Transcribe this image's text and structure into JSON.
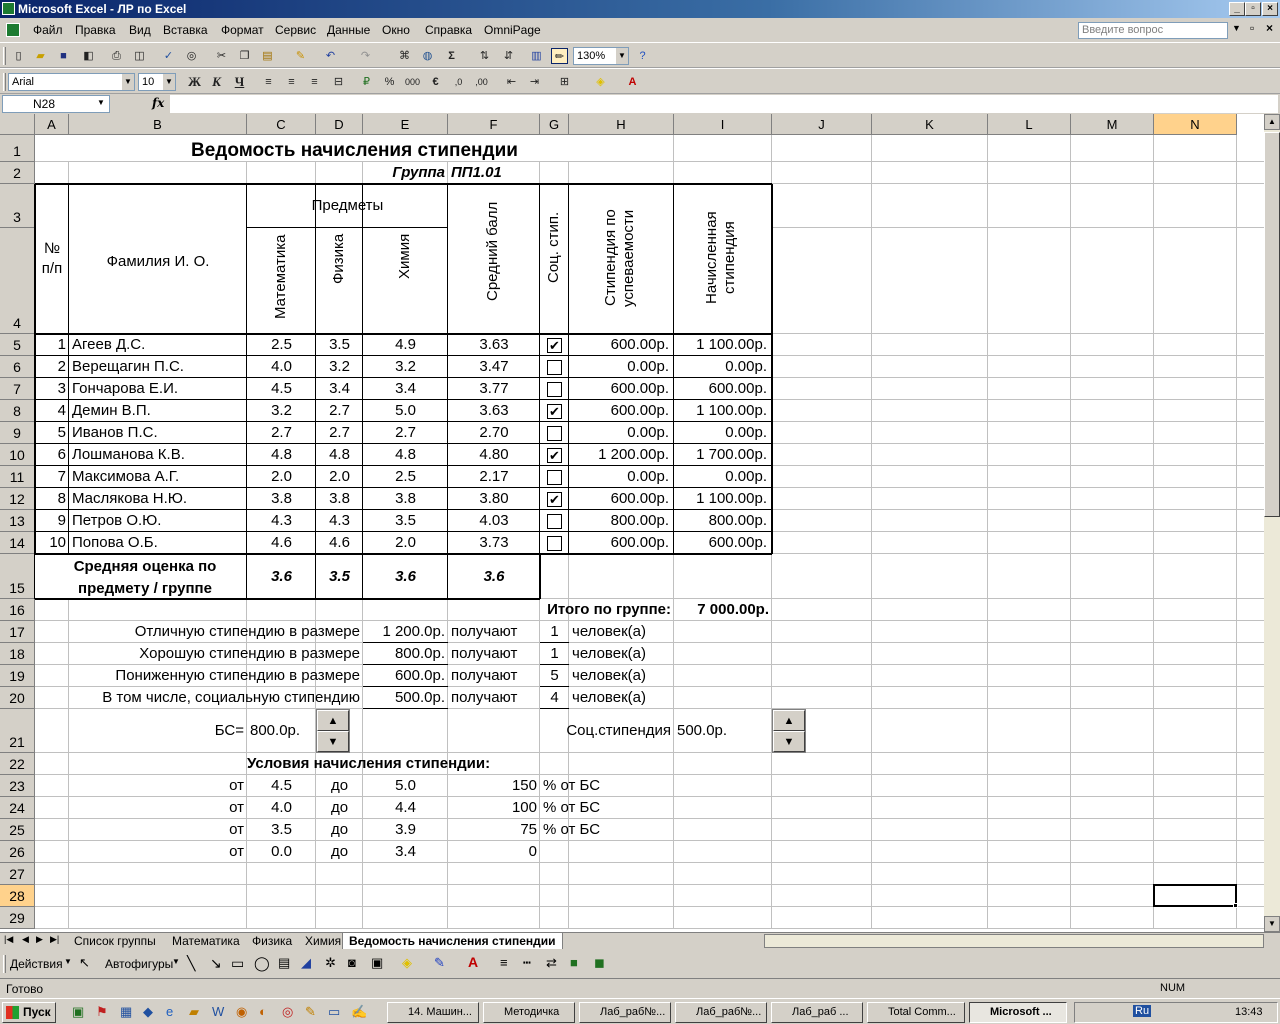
{
  "window": {
    "title": "Microsoft Excel - ЛР по Excel"
  },
  "menu": [
    "Файл",
    "Правка",
    "Вид",
    "Вставка",
    "Формат",
    "Сервис",
    "Данные",
    "Окно",
    "Справка",
    "OmniPage"
  ],
  "ask_placeholder": "Введите вопрос",
  "toolbar": {
    "zoom": "130%",
    "font": "Arial",
    "size": "10"
  },
  "namebox": "N28",
  "columns": [
    "A",
    "B",
    "C",
    "D",
    "E",
    "F",
    "G",
    "H",
    "I",
    "J",
    "K",
    "L",
    "M",
    "N"
  ],
  "rows": [
    "1",
    "2",
    "3",
    "4",
    "5",
    "6",
    "7",
    "8",
    "9",
    "10",
    "11",
    "12",
    "13",
    "14",
    "15",
    "16",
    "17",
    "18",
    "19",
    "20",
    "21",
    "22",
    "23",
    "24",
    "25",
    "26",
    "27",
    "28",
    "29"
  ],
  "sheet": {
    "title": "Ведомость начисления стипендии",
    "group_label": "Группа",
    "group_value": "ПП1.01",
    "hdr_num": "№ п/п",
    "hdr_name": "Фамилия И. О.",
    "hdr_subjects": "Предметы",
    "hdr_math": "Математика",
    "hdr_phys": "Физика",
    "hdr_chem": "Химия",
    "hdr_avg": "Средний балл",
    "hdr_soc": "Соц. стип.",
    "hdr_perf": "Стипендия по успеваемости",
    "hdr_total": "Начисленная стипендия",
    "students": [
      {
        "n": "1",
        "name": "Агеев Д.С.",
        "m": "2.5",
        "p": "3.5",
        "c": "4.9",
        "avg": "3.63",
        "soc": true,
        "perf": "600.00р.",
        "total": "1 100.00р."
      },
      {
        "n": "2",
        "name": "Верещагин П.С.",
        "m": "4.0",
        "p": "3.2",
        "c": "3.2",
        "avg": "3.47",
        "soc": false,
        "perf": "0.00р.",
        "total": "0.00р."
      },
      {
        "n": "3",
        "name": "Гончарова Е.И.",
        "m": "4.5",
        "p": "3.4",
        "c": "3.4",
        "avg": "3.77",
        "soc": false,
        "perf": "600.00р.",
        "total": "600.00р."
      },
      {
        "n": "4",
        "name": "Демин В.П.",
        "m": "3.2",
        "p": "2.7",
        "c": "5.0",
        "avg": "3.63",
        "soc": true,
        "perf": "600.00р.",
        "total": "1 100.00р."
      },
      {
        "n": "5",
        "name": "Иванов П.С.",
        "m": "2.7",
        "p": "2.7",
        "c": "2.7",
        "avg": "2.70",
        "soc": false,
        "perf": "0.00р.",
        "total": "0.00р."
      },
      {
        "n": "6",
        "name": "Лошманова К.В.",
        "m": "4.8",
        "p": "4.8",
        "c": "4.8",
        "avg": "4.80",
        "soc": true,
        "perf": "1 200.00р.",
        "total": "1 700.00р."
      },
      {
        "n": "7",
        "name": "Максимова А.Г.",
        "m": "2.0",
        "p": "2.0",
        "c": "2.5",
        "avg": "2.17",
        "soc": false,
        "perf": "0.00р.",
        "total": "0.00р."
      },
      {
        "n": "8",
        "name": "Маслякова Н.Ю.",
        "m": "3.8",
        "p": "3.8",
        "c": "3.8",
        "avg": "3.80",
        "soc": true,
        "perf": "600.00р.",
        "total": "1 100.00р."
      },
      {
        "n": "9",
        "name": "Петров О.Ю.",
        "m": "4.3",
        "p": "4.3",
        "c": "3.5",
        "avg": "4.03",
        "soc": false,
        "perf": "800.00р.",
        "total": "800.00р."
      },
      {
        "n": "10",
        "name": "Попова О.Б.",
        "m": "4.6",
        "p": "4.6",
        "c": "2.0",
        "avg": "3.73",
        "soc": false,
        "perf": "600.00р.",
        "total": "600.00р."
      }
    ],
    "avg_label": "Средняя оценка по предмету / группе",
    "avg_math": "3.6",
    "avg_phys": "3.5",
    "avg_chem": "3.6",
    "avg_group": "3.6",
    "total_label": "Итого по группе:",
    "total_value": "7 000.00р.",
    "summary": [
      {
        "label": "Отличную стипендию в размере",
        "amount": "1 200.0р.",
        "verb": "получают",
        "count": "1",
        "unit": "человек(а)"
      },
      {
        "label": "Хорошую стипендию в размере",
        "amount": "800.0р.",
        "verb": "получают",
        "count": "1",
        "unit": "человек(а)"
      },
      {
        "label": "Пониженную стипендию в размере",
        "amount": "600.0р.",
        "verb": "получают",
        "count": "5",
        "unit": "человек(а)"
      },
      {
        "label": "В том числе, социальную стипендию",
        "amount": "500.0р.",
        "verb": "получают",
        "count": "4",
        "unit": "человек(а)"
      }
    ],
    "bs_label": "БС=",
    "bs_value": "800.0р.",
    "soc_label": "Соц.стипендия",
    "soc_value": "500.0р.",
    "conditions_title": "Условия начисления стипендии:",
    "conditions": [
      {
        "from": "от",
        "lo": "4.5",
        "to": "до",
        "hi": "5.0",
        "pct": "150",
        "unit": "% от БС"
      },
      {
        "from": "от",
        "lo": "4.0",
        "to": "до",
        "hi": "4.4",
        "pct": "100",
        "unit": "% от БС"
      },
      {
        "from": "от",
        "lo": "3.5",
        "to": "до",
        "hi": "3.9",
        "pct": "75",
        "unit": "% от БС"
      },
      {
        "from": "от",
        "lo": "0.0",
        "to": "до",
        "hi": "3.4",
        "pct": "0",
        "unit": ""
      }
    ]
  },
  "tabs": [
    "Список группы",
    "Математика",
    "Физика",
    "Химия",
    "Ведомость начисления стипендии"
  ],
  "drawbar": {
    "actions": "Действия",
    "autoshapes": "Автофигуры"
  },
  "status": {
    "ready": "Готово",
    "num": "NUM"
  },
  "taskbar": {
    "start": "Пуск",
    "buttons": [
      "14. Машин...",
      "Методичка",
      "Лаб_раб№...",
      "Лаб_раб№...",
      "Лаб_раб ...",
      "Total Comm...",
      "Microsoft ..."
    ],
    "clock": "13:43",
    "lang": "Ru"
  }
}
